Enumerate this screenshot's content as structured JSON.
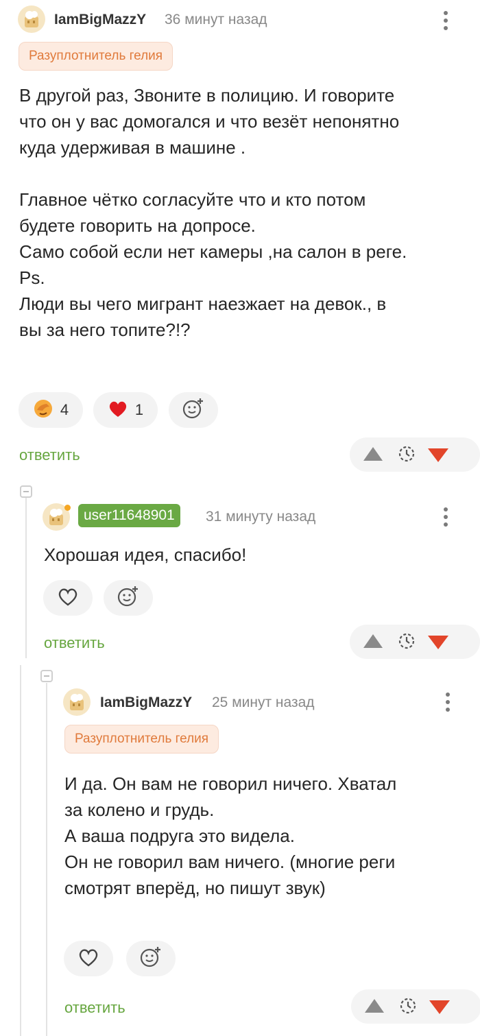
{
  "comments": [
    {
      "username": "IamBigMazzY",
      "time": "36 минут назад",
      "award": "Разуплотнитель гелия",
      "text": "В другой раз, Звоните в полицию. И говорите\nчто он у вас домогался и что везёт непонятно\nкуда удерживая в машине .\n\nГлавное чётко согласуйте что и кто потом\nбудете говорить на допросе.\nСамо собой если нет камеры ,на салон в реге.\nPs.\nЛюди вы чего мигрант наезжает на девок., в\nвы за него топите?!?",
      "reactions": [
        {
          "icon": "facepalm-emoji-icon",
          "count": "4"
        },
        {
          "icon": "heart-icon",
          "count": "1"
        }
      ],
      "reply_label": "ответить"
    },
    {
      "username": "user11648901",
      "time": "31 минуту назад",
      "text": "Хорошая идея, спасибо!",
      "reply_label": "ответить"
    },
    {
      "username": "IamBigMazzY",
      "time": "25 минут назад",
      "award": "Разуплотнитель гелия",
      "text": "И да. Он вам не говорил ничего. Хватал\nза колено и грудь.\nА ваша подруга это видела.\nОн не говорил вам ничего. (многие реги\nсмотрят вперёд, но пишут звук)",
      "reply_label": "ответить"
    }
  ],
  "colors": {
    "accent_green": "#66a63f",
    "upvote": "#8a8a8a",
    "downvote": "#e2452a",
    "award_text": "#e07a3b",
    "heart_red": "#e21b22"
  }
}
